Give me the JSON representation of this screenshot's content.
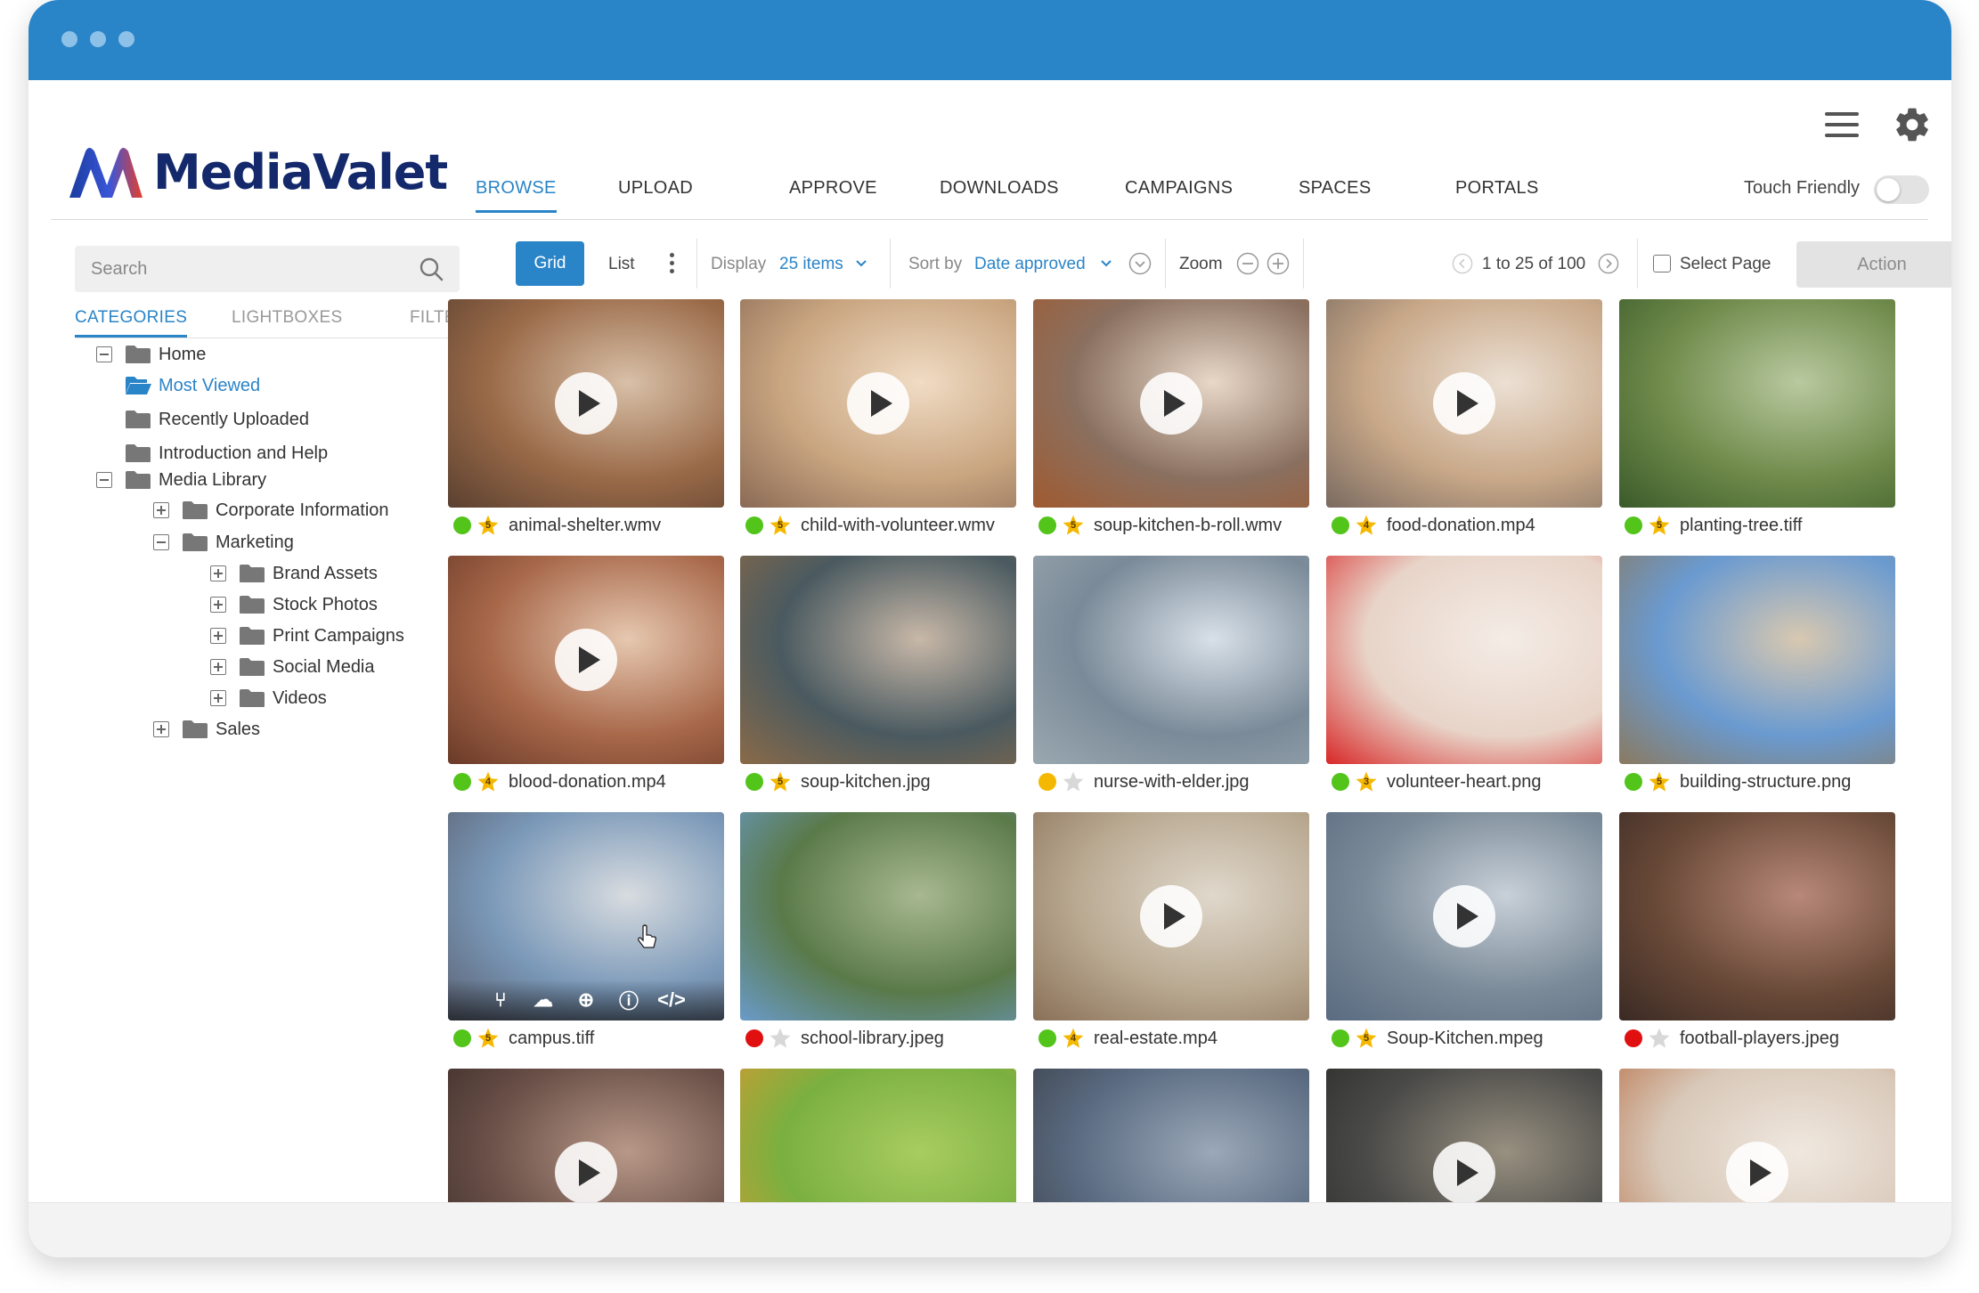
{
  "app": {
    "brand": "MediaValet"
  },
  "nav": [
    "BROWSE",
    "UPLOAD",
    "APPROVE",
    "DOWNLOADS",
    "CAMPAIGNS",
    "SPACES",
    "PORTALS"
  ],
  "header": {
    "touch_friendly_label": "Touch Friendly",
    "touch_friendly_on": false
  },
  "sidebar": {
    "search_placeholder": "Search",
    "tabs": [
      "CATEGORIES",
      "LIGHTBOXES",
      "FILTERS"
    ],
    "tree": [
      {
        "label": "Home",
        "expander": "minus",
        "icon": "folder"
      },
      {
        "label": "Most Viewed",
        "expander": "none",
        "icon": "folder-open",
        "selected": true
      },
      {
        "label": "Recently Uploaded",
        "expander": "none",
        "icon": "folder"
      },
      {
        "label": "Introduction and Help",
        "expander": "none",
        "icon": "folder"
      },
      {
        "label": "Media Library",
        "expander": "minus",
        "icon": "folder"
      },
      {
        "label": "Corporate Information",
        "expander": "plus",
        "icon": "folder"
      },
      {
        "label": "Marketing",
        "expander": "minus",
        "icon": "folder"
      },
      {
        "label": "Brand Assets",
        "expander": "plus",
        "icon": "folder"
      },
      {
        "label": "Stock Photos",
        "expander": "plus",
        "icon": "folder"
      },
      {
        "label": "Print Campaigns",
        "expander": "plus",
        "icon": "folder"
      },
      {
        "label": "Social Media",
        "expander": "plus",
        "icon": "folder"
      },
      {
        "label": "Videos",
        "expander": "plus",
        "icon": "folder"
      },
      {
        "label": "Sales",
        "expander": "plus",
        "icon": "folder"
      }
    ]
  },
  "toolbar": {
    "grid_label": "Grid",
    "list_label": "List",
    "display_label": "Display",
    "display_value": "25 items",
    "sort_label": "Sort by",
    "sort_value": "Date approved",
    "zoom_label": "Zoom",
    "pagination": "1 to 25 of 100",
    "select_page_label": "Select Page",
    "action_label": "Action"
  },
  "colors": {
    "accent": "#2a84c8",
    "brand": "#13296b",
    "status_green": "#52c41a",
    "status_yellow": "#f5b800",
    "status_red": "#e01010"
  },
  "assets": [
    {
      "name": "animal-shelter.wmv",
      "status": "green",
      "rating": "5",
      "video": true
    },
    {
      "name": "child-with-volunteer.wmv",
      "status": "green",
      "rating": "5",
      "video": true
    },
    {
      "name": "soup-kitchen-b-roll.wmv",
      "status": "green",
      "rating": "5",
      "video": true
    },
    {
      "name": "food-donation.mp4",
      "status": "green",
      "rating": "4",
      "video": true
    },
    {
      "name": "planting-tree.tiff",
      "status": "green",
      "rating": "5",
      "video": false
    },
    {
      "name": "blood-donation.mp4",
      "status": "green",
      "rating": "4",
      "video": true
    },
    {
      "name": "soup-kitchen.jpg",
      "status": "green",
      "rating": "5",
      "video": false
    },
    {
      "name": "nurse-with-elder.jpg",
      "status": "yellow",
      "rating": "",
      "video": false
    },
    {
      "name": "volunteer-heart.png",
      "status": "green",
      "rating": "3",
      "video": false
    },
    {
      "name": "building-structure.png",
      "status": "green",
      "rating": "5",
      "video": false
    },
    {
      "name": "campus.tiff",
      "status": "green",
      "rating": "5",
      "video": false,
      "hovered": true
    },
    {
      "name": "school-library.jpeg",
      "status": "red",
      "rating": "",
      "video": false
    },
    {
      "name": "real-estate.mp4",
      "status": "green",
      "rating": "4",
      "video": true
    },
    {
      "name": "Soup-Kitchen.mpeg",
      "status": "green",
      "rating": "5",
      "video": true
    },
    {
      "name": "football-players.jpeg",
      "status": "red",
      "rating": "",
      "video": false
    },
    {
      "name": "",
      "status": "",
      "rating": "",
      "video": true
    },
    {
      "name": "",
      "status": "",
      "rating": "",
      "video": false
    },
    {
      "name": "",
      "status": "",
      "rating": "",
      "video": false
    },
    {
      "name": "",
      "status": "",
      "rating": "",
      "video": true
    },
    {
      "name": "",
      "status": "",
      "rating": "",
      "video": true
    }
  ],
  "hover_actions": [
    "share-icon",
    "download-icon",
    "add-icon",
    "info-icon",
    "embed-icon"
  ]
}
